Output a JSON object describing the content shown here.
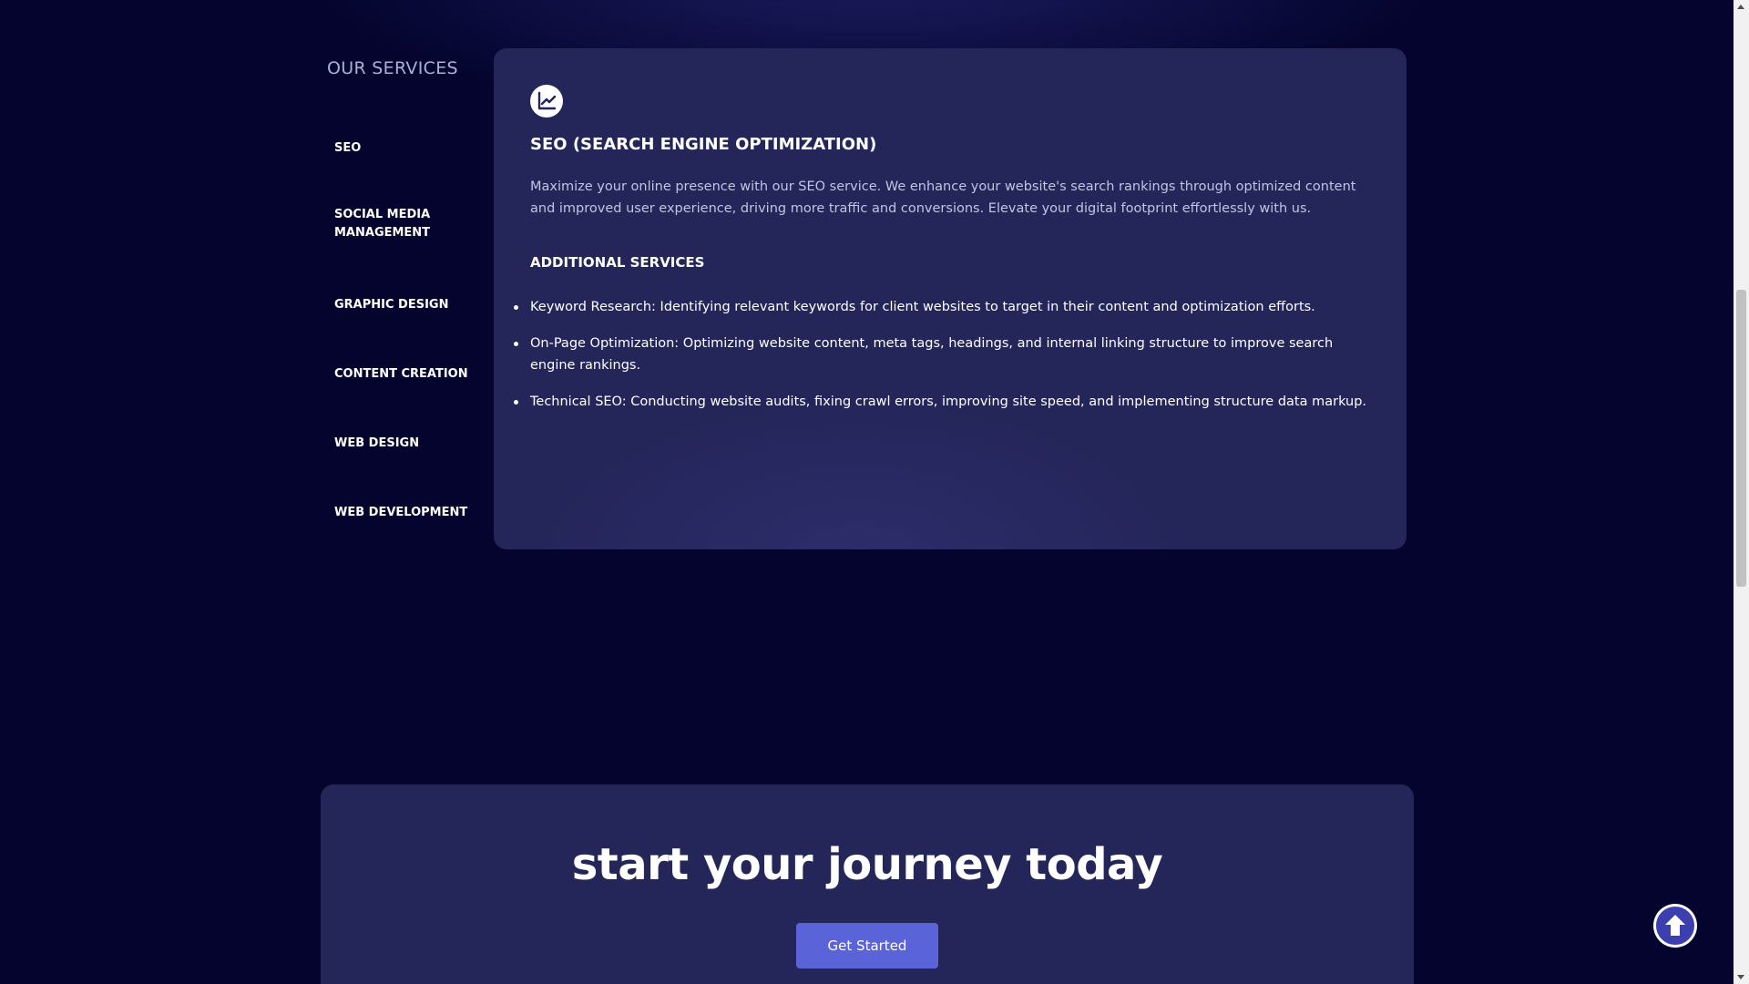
{
  "sidebar": {
    "heading": "OUR SERVICES",
    "items": [
      {
        "label": "SEO"
      },
      {
        "label": "SOCIAL MEDIA MANAGEMENT"
      },
      {
        "label": "GRAPHIC DESIGN"
      },
      {
        "label": "CONTENT CREATION"
      },
      {
        "label": "WEB DESIGN"
      },
      {
        "label": "WEB DEVELOPMENT"
      }
    ]
  },
  "service": {
    "icon": "line-chart-icon",
    "title": "SEO (SEARCH ENGINE OPTIMIZATION)",
    "description": "Maximize your online presence with our SEO service. We enhance your website's search rankings through optimized content and improved user experience, driving more traffic and conversions. Elevate your digital footprint effortlessly with us.",
    "additional_heading": "ADDITIONAL SERVICES",
    "additional_items": [
      "Keyword Research: Identifying relevant keywords for client websites to target in their content and optimization efforts.",
      "On-Page Optimization: Optimizing website content, meta tags, headings, and internal linking structure to improve search engine rankings.",
      "Technical SEO: Conducting website audits, fixing crawl errors, improving site speed, and implementing structure data markup."
    ]
  },
  "cta": {
    "title": "start your journey today",
    "button_label": "Get Started"
  },
  "scroll_top": {
    "icon": "arrow-up-circle-icon"
  },
  "colors": {
    "page_background": "#04042e",
    "card_background": "#242559",
    "accent_button": "#5b63d8",
    "muted_text": "#c1c5e2"
  }
}
